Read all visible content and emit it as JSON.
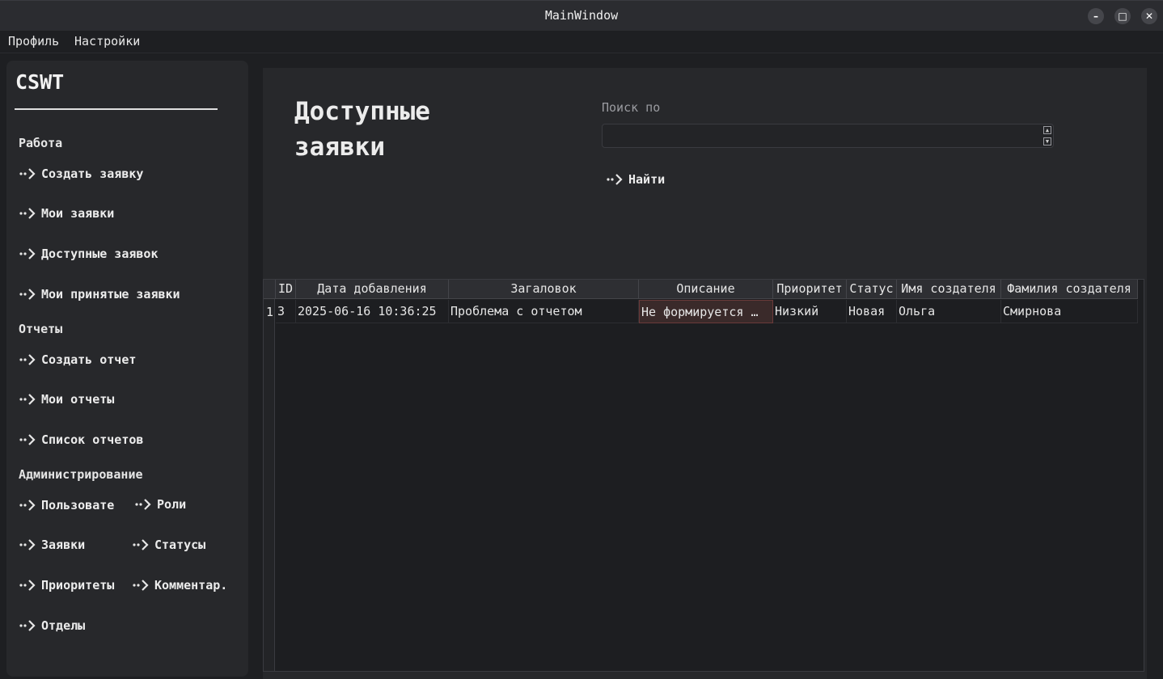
{
  "window": {
    "title": "MainWindow",
    "minimize_glyph": "–",
    "maximize_glyph": "□",
    "close_glyph": "✕"
  },
  "menu": [
    "Профиль",
    "Настройки"
  ],
  "sidebar": {
    "logo": "CSWT",
    "sections": {
      "work": "Работа",
      "reports": "Отчеты",
      "admin": "Администрирование"
    },
    "work_items": [
      "Создать заявку",
      "Мои заявки",
      "Доступные заявок",
      "Мои принятые заявки"
    ],
    "report_items": [
      "Создать отчет",
      "Мои отчеты",
      "Список отчетов"
    ],
    "admin_items": [
      "Пользовате",
      "Роли",
      "Заявки",
      "Статусы",
      "Приоритеты",
      "Комментар.",
      "Отделы"
    ],
    "arrow_icon": "dotted-arrow-icon"
  },
  "main": {
    "title_line1": "Доступные",
    "title_line2": "заявки",
    "search_label": "Поиск по",
    "search_value": "",
    "find_button": "Найти"
  },
  "table": {
    "columns": [
      "ID",
      "Дата добавления",
      "Загаловок",
      "Описание",
      "Приоритет",
      "Статус",
      "Имя создателя",
      "Фамилия создателя"
    ],
    "rows": [
      {
        "row_number": "1",
        "cells": [
          "3",
          "2025-06-16 10:36:25",
          "Проблема с отчетом",
          "Не формируется …",
          "Низкий",
          "Новая",
          "Ольга",
          "Смирнова"
        ]
      }
    ]
  },
  "colors": {
    "background": "#1e1f22",
    "panel": "#27282b",
    "text": "#e6e6e6"
  }
}
